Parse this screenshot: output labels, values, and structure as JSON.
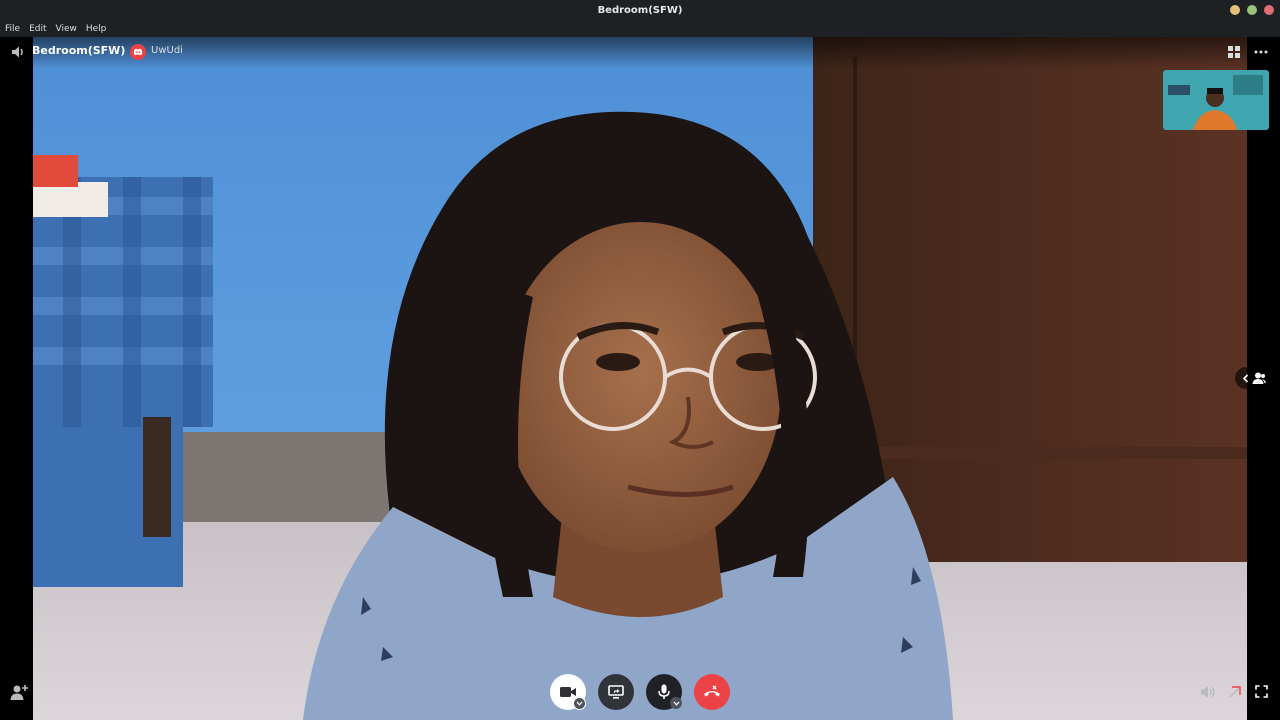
{
  "window": {
    "title": "Bedroom(SFW)",
    "controls": [
      {
        "name": "minimize",
        "color": "#e5c07b"
      },
      {
        "name": "maximize",
        "color": "#98c379"
      },
      {
        "name": "close",
        "color": "#e06c75"
      }
    ]
  },
  "menubar": {
    "items": [
      "File",
      "Edit",
      "View",
      "Help"
    ]
  },
  "call": {
    "channel_name": "Bedroom(SFW)",
    "server_name": "UwUdi",
    "server_icon": "discord-icon",
    "server_color": "#ed4245"
  },
  "controls": {
    "camera_icon": "video-camera-icon",
    "share_icon": "screen-share-icon",
    "mic_icon": "microphone-icon",
    "leave_icon": "phone-hangup-icon",
    "leave_color": "#ed4245"
  }
}
